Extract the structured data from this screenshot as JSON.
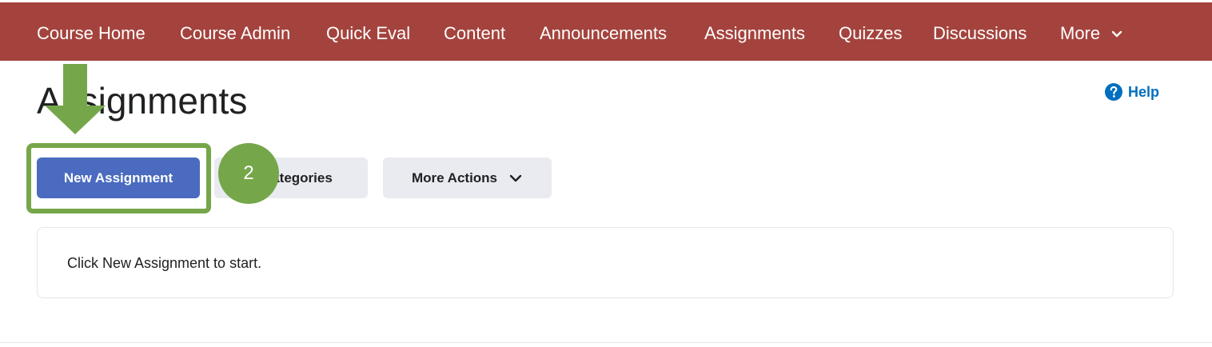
{
  "navbar": {
    "color": "#a4433d",
    "items": [
      {
        "label": "Course Home"
      },
      {
        "label": "Course Admin"
      },
      {
        "label": "Quick Eval"
      },
      {
        "label": "Content"
      },
      {
        "label": "Announcements"
      },
      {
        "label": "Assignments"
      },
      {
        "label": "Quizzes"
      },
      {
        "label": "Discussions"
      },
      {
        "label": "More",
        "icon": "chevron-down-icon"
      }
    ]
  },
  "page": {
    "title": "Assignments",
    "help": {
      "label": "Help",
      "icon": "help-icon",
      "color": "#006fbf"
    }
  },
  "toolbar": {
    "new_assignment_label": "New Assignment",
    "categories_label": "Categories",
    "categories_visible_label": "ategories",
    "more_actions_label": "More Actions",
    "primary_color": "#4a6bbf"
  },
  "empty_state": {
    "message": "Click New Assignment to start."
  },
  "annotation": {
    "step_number": "2",
    "color": "#76a64a",
    "arrow_icon": "arrow-down-icon"
  }
}
